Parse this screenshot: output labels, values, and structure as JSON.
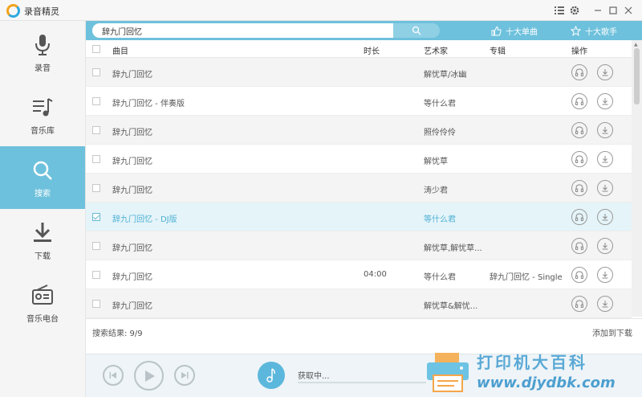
{
  "app": {
    "title": "录音精灵"
  },
  "sidebar": {
    "items": [
      {
        "label": "录音",
        "icon": "microphone-icon",
        "active": false
      },
      {
        "label": "音乐库",
        "icon": "music-library-icon",
        "active": false
      },
      {
        "label": "搜索",
        "icon": "search-icon",
        "active": true
      },
      {
        "label": "下载",
        "icon": "download-icon",
        "active": false
      },
      {
        "label": "音乐电台",
        "icon": "radio-icon",
        "active": false
      }
    ]
  },
  "search": {
    "value": "辞九门回忆",
    "placeholder": "",
    "top_songs_label": "十大单曲",
    "top_singers_label": "十大歌手"
  },
  "table": {
    "headers": {
      "song": "曲目",
      "duration": "时长",
      "artist": "艺术家",
      "album": "专辑",
      "actions": "操作"
    },
    "rows": [
      {
        "song": "辞九门回忆",
        "duration": "",
        "artist": "解忧草/冰幽",
        "album": "",
        "checked": false,
        "selected": false
      },
      {
        "song": "辞九门回忆 - 伴奏版",
        "duration": "",
        "artist": "等什么君",
        "album": "",
        "checked": false,
        "selected": false
      },
      {
        "song": "辞九门回忆",
        "duration": "",
        "artist": "照伶伶伶",
        "album": "",
        "checked": false,
        "selected": false
      },
      {
        "song": "辞九门回忆",
        "duration": "",
        "artist": "解忧草",
        "album": "",
        "checked": false,
        "selected": false
      },
      {
        "song": "辞九门回忆",
        "duration": "",
        "artist": "涛少君",
        "album": "",
        "checked": false,
        "selected": false
      },
      {
        "song": "辞九门回忆 - DJ版",
        "duration": "",
        "artist": "等什么君",
        "album": "",
        "checked": true,
        "selected": true
      },
      {
        "song": "辞九门回忆",
        "duration": "",
        "artist": "解忧草,解忧草...",
        "album": "",
        "checked": false,
        "selected": false
      },
      {
        "song": "辞九门回忆",
        "duration": "04:00",
        "artist": "等什么君",
        "album": "辞九门回忆 - Single",
        "checked": false,
        "selected": false
      },
      {
        "song": "辞九门回忆",
        "duration": "",
        "artist": "解忧草&解忧...",
        "album": "",
        "checked": false,
        "selected": false
      }
    ]
  },
  "footer": {
    "result_count": "搜索结果: 9/9",
    "add_download": "添加到下载"
  },
  "player": {
    "status": "获取中...",
    "progress": 0
  },
  "watermark": {
    "text": "打印机大百科",
    "url": "www.djydbk.com"
  },
  "colors": {
    "accent": "#6ec1dc",
    "selected_text": "#4cb0d3",
    "selected_row": "#e5f4f9"
  }
}
